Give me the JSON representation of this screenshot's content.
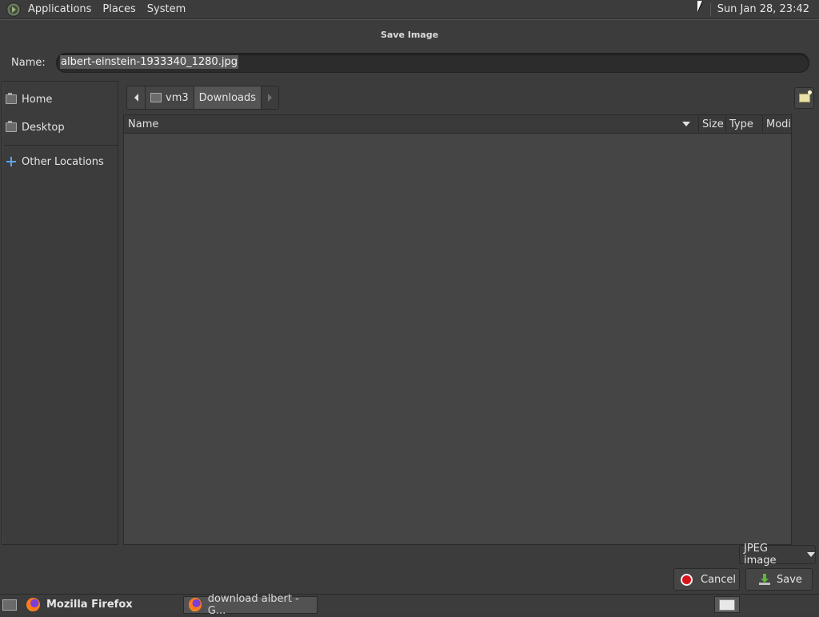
{
  "top_panel": {
    "menus": [
      "Applications",
      "Places",
      "System"
    ],
    "clock": "Sun Jan 28, 23:42"
  },
  "dialog": {
    "title": "Save Image",
    "name_label": "Name:",
    "filename": "albert-einstein-1933340_1280.jpg"
  },
  "sidebar": {
    "items": [
      {
        "label": "Home",
        "icon": "home-folder-icon"
      },
      {
        "label": "Desktop",
        "icon": "desktop-folder-icon"
      },
      {
        "label": "Other Locations",
        "icon": "plus-icon"
      }
    ]
  },
  "pathbar": {
    "segments": [
      "vm3",
      "Downloads"
    ],
    "active": "Downloads"
  },
  "filelist": {
    "columns": [
      "Name",
      "Size",
      "Type",
      "Modif"
    ],
    "rows": []
  },
  "controls": {
    "filetype": "JPEG image",
    "cancel_label": "Cancel",
    "save_label": "Save"
  },
  "taskbar": {
    "tasks": [
      "Mozilla Firefox",
      "download albert - G..."
    ]
  }
}
